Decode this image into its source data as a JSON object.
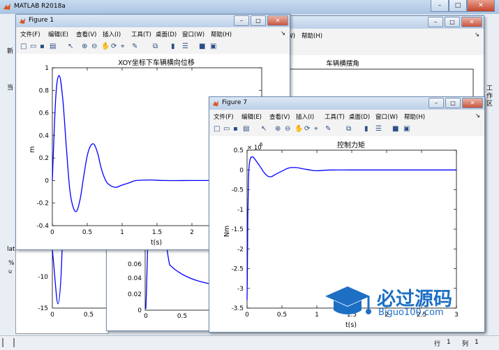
{
  "app": {
    "title": "MATLAB R2018a"
  },
  "menu": [
    "文件(F)",
    "编辑(E)",
    "查看(V)",
    "插入(I)",
    "工具(T)",
    "桌面(D)",
    "窗口(W)",
    "帮助(H)"
  ],
  "window_controls": {
    "minimize": "–",
    "maximize": "□",
    "close": "✕"
  },
  "status": {
    "row_label": "行",
    "row": "1",
    "col_label": "列",
    "col": "1"
  },
  "background_bits": {
    "new_label": "新",
    "left_fragment": "当",
    "workspace_label": "工作区",
    "lat_fragment": "lat",
    "pct": "%",
    "u": "u"
  },
  "figures": [
    {
      "name": "Figure 1",
      "plot_title": "XOY坐标下车辆横向位移",
      "xlabel": "t(s)",
      "ylabel": "m"
    },
    {
      "name": "",
      "plot_title": "车辆横摆角"
    },
    {
      "name": "Figure 7",
      "plot_title": "控制力矩",
      "xlabel": "t(s)",
      "ylabel": "Nm",
      "y_exponent_base": "× 10",
      "y_exponent": "6"
    }
  ],
  "behind_plots": {
    "left": {
      "yticks": [
        "-10",
        "-15"
      ],
      "xticks": [
        "0",
        "0.5"
      ]
    },
    "middle": {
      "yticks": [
        "0.06",
        "0.04",
        "0.02",
        "0"
      ],
      "xticks": [
        "0",
        "0.5",
        "1"
      ]
    }
  },
  "chart_data": [
    {
      "type": "line",
      "title": "XOY坐标下车辆横向位移",
      "xlabel": "t(s)",
      "ylabel": "m",
      "xlim": [
        0,
        3
      ],
      "ylim": [
        -0.4,
        1
      ],
      "xticks": [
        "0",
        "0.5",
        "1",
        "1.5",
        "2"
      ],
      "yticks": [
        "1",
        "0.8",
        "0.6",
        "0.4",
        "0.2",
        "0",
        "-0.2",
        "-0.4"
      ],
      "series": [
        {
          "color": "#0000ff",
          "x": [
            0,
            0.05,
            0.1,
            0.15,
            0.2,
            0.25,
            0.3,
            0.35,
            0.4,
            0.45,
            0.5,
            0.55,
            0.6,
            0.65,
            0.7,
            0.75,
            0.8,
            0.9,
            1.0,
            1.1,
            1.2,
            1.4,
            1.6,
            2.0,
            2.5,
            3.0
          ],
          "y": [
            0,
            0.75,
            0.93,
            0.72,
            0.3,
            -0.08,
            -0.24,
            -0.27,
            -0.16,
            0.04,
            0.22,
            0.31,
            0.32,
            0.24,
            0.11,
            0.02,
            -0.03,
            -0.06,
            -0.04,
            -0.02,
            0.0,
            0.005,
            0.0,
            0.0,
            0.0,
            0.0
          ]
        }
      ]
    },
    {
      "type": "line",
      "title": "控制力矩",
      "xlabel": "t(s)",
      "ylabel": "Nm",
      "y_exponent": 6,
      "xlim": [
        0,
        3
      ],
      "ylim": [
        -3.5,
        0.5
      ],
      "xticks": [
        "0",
        "0.5",
        "1",
        "1.5",
        "2",
        "2.5",
        "3"
      ],
      "yticks": [
        "0.5",
        "0",
        "-0.5",
        "-1",
        "-1.5",
        "-2",
        "-2.5",
        "-3",
        "-3.5"
      ],
      "series": [
        {
          "color": "#0000ff",
          "x": [
            0,
            0.005,
            0.01,
            0.02,
            0.03,
            0.05,
            0.08,
            0.1,
            0.15,
            0.2,
            0.25,
            0.3,
            0.35,
            0.4,
            0.5,
            0.6,
            0.7,
            0.8,
            0.9,
            1.0,
            1.2,
            1.5,
            2.0,
            2.5,
            3.0
          ],
          "y": [
            -3.3,
            -2.5,
            -1.3,
            -0.3,
            0.1,
            0.3,
            0.33,
            0.3,
            0.18,
            0.05,
            -0.08,
            -0.16,
            -0.17,
            -0.12,
            -0.03,
            0.05,
            0.06,
            0.03,
            0.0,
            -0.02,
            0.0,
            0.0,
            0.0,
            0.0,
            0.0
          ]
        }
      ]
    }
  ],
  "watermark": {
    "cn": "必过源码",
    "en": "Biguo100.com"
  }
}
